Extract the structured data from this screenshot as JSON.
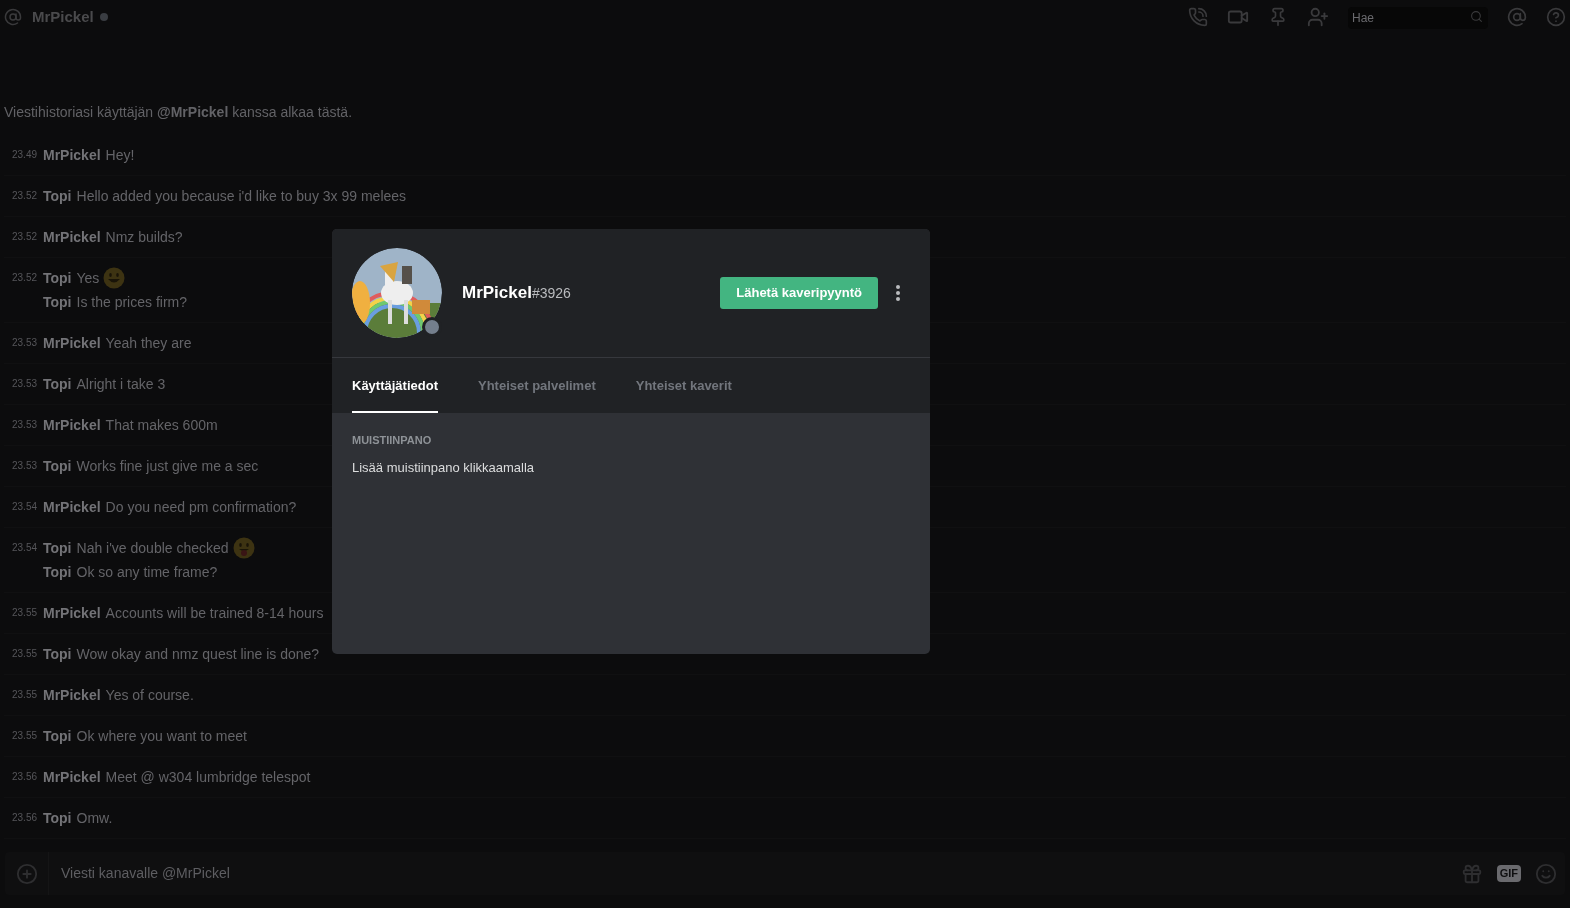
{
  "header": {
    "channel_name": "MrPickel",
    "online": false,
    "search": {
      "placeholder": "Hae"
    }
  },
  "intro": "Viestihistoriasi käyttäjän **@MrPickel** kanssa alkaa tästä.",
  "messages": [
    {
      "time": "23.49",
      "lines": [
        {
          "author": "MrPickel",
          "text": "Hey!"
        }
      ]
    },
    {
      "time": "23.52",
      "lines": [
        {
          "author": "Topi",
          "text": "Hello added you because i'd like to buy 3x 99 melees"
        }
      ]
    },
    {
      "time": "23.52",
      "lines": [
        {
          "author": "MrPickel",
          "text": "Nmz builds?"
        }
      ]
    },
    {
      "time": "23.52",
      "lines": [
        {
          "author": "Topi",
          "text": "Yes",
          "kind": "grinning"
        },
        {
          "author": "Topi",
          "text": "Is the prices firm?"
        }
      ]
    },
    {
      "time": "23.53",
      "lines": [
        {
          "author": "MrPickel",
          "text": "Yeah they are"
        }
      ]
    },
    {
      "time": "23.53",
      "lines": [
        {
          "author": "Topi",
          "text": "Alright i take 3"
        }
      ]
    },
    {
      "time": "23.53",
      "lines": [
        {
          "author": "MrPickel",
          "text": "That makes 600m"
        }
      ]
    },
    {
      "time": "23.53",
      "lines": [
        {
          "author": "Topi",
          "text": "Works fine just give me a sec"
        }
      ]
    },
    {
      "time": "23.54",
      "lines": [
        {
          "author": "MrPickel",
          "text": "Do you need pm confirmation?"
        }
      ]
    },
    {
      "time": "23.54",
      "lines": [
        {
          "author": "Topi",
          "text": "Nah i've double checked",
          "kind": "tongue"
        },
        {
          "author": "Topi",
          "text": "Ok so any time frame?"
        }
      ]
    },
    {
      "time": "23.55",
      "lines": [
        {
          "author": "MrPickel",
          "text": "Accounts will be trained 8-14 hours"
        }
      ]
    },
    {
      "time": "23.55",
      "lines": [
        {
          "author": "Topi",
          "text": "Wow okay and nmz quest line is done?"
        }
      ]
    },
    {
      "time": "23.55",
      "lines": [
        {
          "author": "MrPickel",
          "text": "Yes of course."
        }
      ]
    },
    {
      "time": "23.55",
      "lines": [
        {
          "author": "Topi",
          "text": "Ok where you want to meet"
        }
      ]
    },
    {
      "time": "23.56",
      "lines": [
        {
          "author": "MrPickel",
          "text": "Meet @ w304 lumbridge telespot"
        }
      ]
    },
    {
      "time": "23.56",
      "lines": [
        {
          "author": "Topi",
          "text": "Omw."
        }
      ]
    }
  ],
  "composer": {
    "placeholder": "Viesti kanavalle @MrPickel",
    "gif_label": "GIF"
  },
  "profile": {
    "username": "MrPickel",
    "discriminator": "#3926",
    "online": false,
    "action_button": "Lähetä kaveripyyntö",
    "tabs": [
      {
        "label": "Käyttäjätiedot",
        "selected": true
      },
      {
        "label": "Yhteiset palvelimet",
        "selected": false
      },
      {
        "label": "Yhteiset kaverit",
        "selected": false
      }
    ],
    "note_heading": "MUISTIINPANO",
    "note_placeholder": "Lisää muistiinpano klikkaamalla"
  }
}
